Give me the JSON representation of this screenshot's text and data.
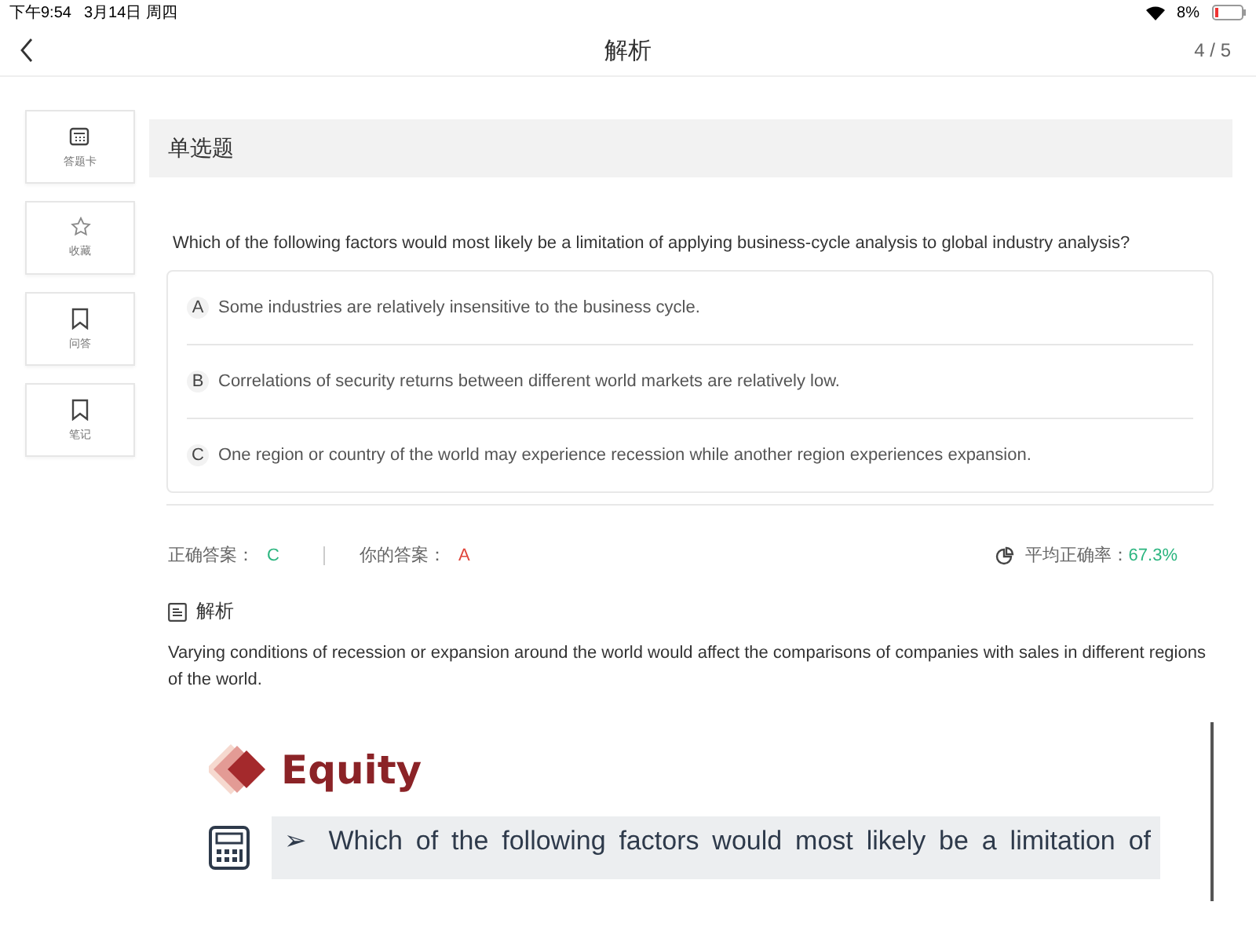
{
  "status_bar": {
    "time": "下午9:54",
    "date": "3月14日 周四",
    "battery": "8%"
  },
  "nav": {
    "title": "解析",
    "page": "4 / 5"
  },
  "sidebar": [
    {
      "kind": "card",
      "label": "答题卡"
    },
    {
      "kind": "star",
      "label": "收藏"
    },
    {
      "kind": "bookmark",
      "label": "问答"
    },
    {
      "kind": "bookmark",
      "label": "笔记"
    }
  ],
  "question_type": "单选题",
  "question": "Which of the following factors would most likely be a limitation of applying business-cycle analysis to global industry analysis?",
  "options": [
    {
      "letter": "A",
      "text": "Some industries are relatively insensitive to the business cycle."
    },
    {
      "letter": "B",
      "text": "Correlations of security returns between different world markets are relatively low."
    },
    {
      "letter": "C",
      "text": "One region or country of the world may experience recession while another region experiences expansion."
    }
  ],
  "result": {
    "correct_label": "正确答案：",
    "correct": "C",
    "yours_label": "你的答案：",
    "yours": "A",
    "rate_label": "平均正确率：",
    "rate": "67.3%"
  },
  "analysis": {
    "heading": "解析",
    "text": "Varying conditions of recession or expansion around the world would affect the comparisons of companies with sales in different regions of the world."
  },
  "slide": {
    "title": "Equity",
    "bullet": "➢",
    "line": "Which of the following factors would most likely be a limitation of"
  }
}
